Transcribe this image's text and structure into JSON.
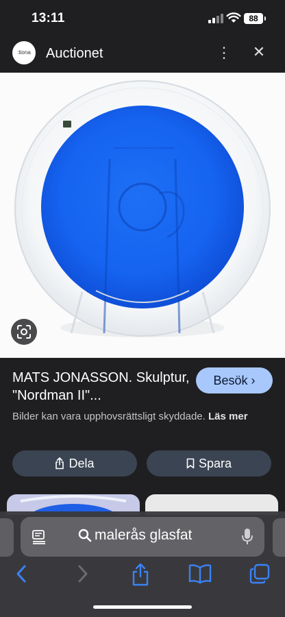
{
  "status": {
    "time": "13:11",
    "battery": "88"
  },
  "header": {
    "logo_text": ":tiona",
    "site_name": "Auctionet"
  },
  "result": {
    "title": "MATS JONASSON. Skulptur, \"Nordman II\"...",
    "visit_label": "Besök ›",
    "copyright_text": "Bilder kan vara upphovsrättsligt skyddade.",
    "read_more": "Läs mer",
    "share_label": "Dela",
    "save_label": "Spara"
  },
  "browser": {
    "search_query": "malerås glasfat"
  },
  "colors": {
    "accent_button": "#a8c7fa",
    "action_button": "#3b4452",
    "glass_blue": "#1565f0",
    "background": "#1f1f21"
  },
  "icons": [
    "signal-icon",
    "wifi-icon",
    "battery-icon",
    "more-vert-icon",
    "close-icon",
    "lens-icon",
    "share-icon",
    "bookmark-icon",
    "reader-icon",
    "search-icon",
    "mic-icon",
    "back-icon",
    "forward-icon",
    "share-sheet-icon",
    "bookmarks-icon",
    "tabs-icon"
  ]
}
